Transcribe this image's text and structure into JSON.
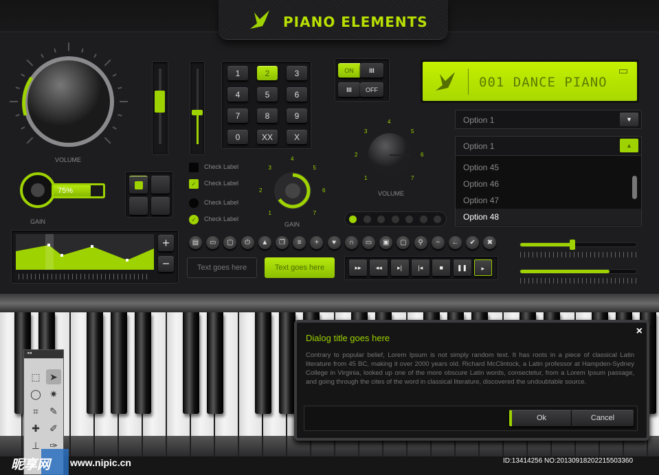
{
  "header": {
    "title": "PIANO ELEMENTS",
    "logo": "bird-icon"
  },
  "volume_knob": {
    "label": "VOLUME",
    "level": 0.3
  },
  "gain_knob": {
    "label": "GAIN",
    "progress": "75%",
    "progress_value": 0.75
  },
  "vertical_sliders": [
    {
      "value": 0.6
    },
    {
      "value": 0.4
    }
  ],
  "keypad": {
    "keys": [
      "1",
      "2",
      "3",
      "4",
      "5",
      "6",
      "7",
      "8",
      "9",
      "0",
      "XX",
      "X"
    ],
    "active": "2"
  },
  "toggles": {
    "on_label": "ON",
    "off_label": "OFF",
    "grip": "III"
  },
  "lcd": {
    "text": "001 DANCE PIANO",
    "icon": "bird-icon",
    "battery": "battery-icon"
  },
  "dropdown1": {
    "value": "Option 1"
  },
  "dropdown2": {
    "value": "Option 1",
    "options": [
      "Option 45",
      "Option 46",
      "Option 47",
      "Option 48"
    ],
    "selected": "Option 48"
  },
  "checkboxes": [
    {
      "label": "Check Label",
      "checked": false
    },
    {
      "label": "Check Label",
      "checked": true
    },
    {
      "label": "Check Label",
      "checked": false
    },
    {
      "label": "Check Label",
      "checked": true
    }
  ],
  "gain_dial": {
    "label": "GAIN",
    "scale": [
      "1",
      "2",
      "3",
      "4",
      "5",
      "6",
      "7"
    ]
  },
  "volume_dial": {
    "label": "VOLUME",
    "scale": [
      "1",
      "2",
      "3",
      "4",
      "5",
      "6",
      "7"
    ]
  },
  "indicator_dots": {
    "count": 7,
    "active": 0
  },
  "eq": {
    "plus": "+",
    "minus": "−"
  },
  "icon_buttons": [
    {
      "n": "film-icon",
      "g": "▤"
    },
    {
      "n": "presentation-icon",
      "g": "▭"
    },
    {
      "n": "chat-icon",
      "g": "▢"
    },
    {
      "n": "power-icon",
      "g": "⏻"
    },
    {
      "n": "hat-icon",
      "g": "▲"
    },
    {
      "n": "copy-icon",
      "g": "❐"
    },
    {
      "n": "message-icon",
      "g": "≡"
    },
    {
      "n": "plus-icon",
      "g": "+"
    },
    {
      "n": "shield-icon",
      "g": "♥"
    },
    {
      "n": "headphones-icon",
      "g": "∩"
    },
    {
      "n": "laptop-icon",
      "g": "▭"
    },
    {
      "n": "lock-icon",
      "g": "▣"
    },
    {
      "n": "tv-icon",
      "g": "▢"
    },
    {
      "n": "search-icon",
      "g": "⚲"
    },
    {
      "n": "minus-icon",
      "g": "−"
    },
    {
      "n": "arrow-left-icon",
      "g": "←"
    },
    {
      "n": "check-icon",
      "g": "✔"
    },
    {
      "n": "close-icon",
      "g": "✖"
    }
  ],
  "tooltips": [
    "Text goes here",
    "Text goes here"
  ],
  "transport": [
    {
      "n": "fast-forward-icon",
      "g": "▸▸"
    },
    {
      "n": "rewind-icon",
      "g": "◂◂"
    },
    {
      "n": "skip-next-icon",
      "g": "▸|"
    },
    {
      "n": "skip-prev-icon",
      "g": "|◂"
    },
    {
      "n": "stop-icon",
      "g": "■"
    },
    {
      "n": "pause-icon",
      "g": "❚❚"
    },
    {
      "n": "play-icon",
      "g": "▸"
    }
  ],
  "h_sliders": [
    {
      "value": 0.45
    },
    {
      "value": 0.77
    }
  ],
  "dialog": {
    "title": "Dialog title goes here",
    "close": "×",
    "body": "Contrary to popular belief, Lorem Ipsum is not simply random text. It has roots in a piece of classical Latin literature from 45 BC, making it over 2000 years old. Richard McClintock, a Latin professor at Hampden-Sydney College in Virginia, looked up one of the more obscure Latin words, consectetur, from a Lorem Ipsum passage, and going through the cites of the word in classical literature, discovered the undoubtable source.",
    "ok": "Ok",
    "cancel": "Cancel"
  },
  "toolbox": {
    "collapse": "◂◂",
    "tools": [
      "marquee-icon",
      "move-icon",
      "lasso-icon",
      "magic-wand-icon",
      "crop-icon",
      "eyedropper-icon",
      "healing-icon",
      "brush-icon",
      "stamp-icon",
      "history-brush-icon"
    ]
  },
  "watermark": {
    "site": "昵享网",
    "url": "www.nipic.cn",
    "id": "ID:13414256 NO:20130918202215503360"
  },
  "colors": {
    "accent": "#9ed200",
    "bg": "#1d1d1f"
  }
}
